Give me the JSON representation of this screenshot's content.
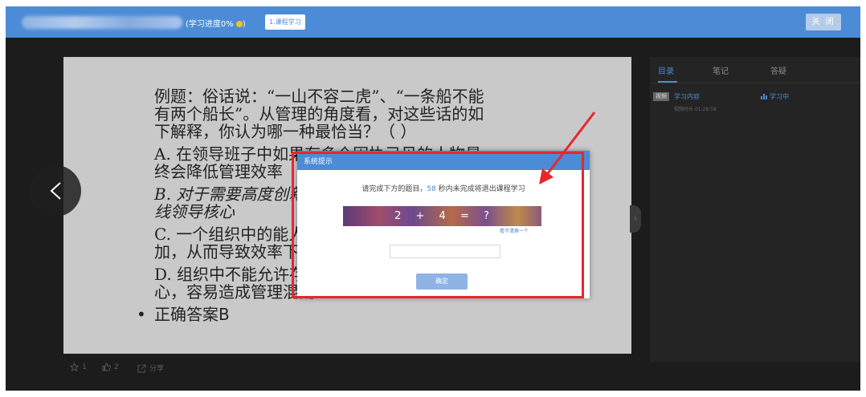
{
  "header": {
    "progress_label": "(学习进度0%",
    "progress_suffix": ")",
    "tag_label": "1.课程学习",
    "close_label": "关 闭",
    "accent_color": "#4c8bd6"
  },
  "slide": {
    "question": "例题：俗话说：“一山不容二虎”、“一条船不能有两个船长”。从管理的角度看，对这些话的如下解释，你认为哪一种最恰当？（    ）",
    "option_a": "A. 在领导班子中如果有多个固执己见的人物最终会降低管理效率",
    "option_b": "B. 对于需要高度创新的任务，必须确立一个直线领导核心",
    "option_c": "C. 一个组织中的能人太多必然会造成内耗增加，从而导致效率下降",
    "option_d": "D. 组织中不能允许存在两个以上的直线领导核心，容易造成管理混乱",
    "answer_bullet": "•",
    "answer": "正确答案B"
  },
  "sidepanel": {
    "tabs": [
      "目录",
      "笔记",
      "答疑"
    ],
    "active_tab": 0,
    "lesson_badge": "视频",
    "lesson_title": "学习内容",
    "lesson_meta": "视频时长 01:28:58",
    "lesson_status": "学习中"
  },
  "bottom_bar": {
    "likes": "1",
    "thumbs": "2",
    "share": "分享"
  },
  "dialog": {
    "title": "系统提示",
    "msg_before": "请完成下方的题目，",
    "seconds": "58",
    "msg_after": " 秒内未完成将退出课程学习",
    "captcha_text": "2 + 4 = ?",
    "refresh_label": "看不清换一个",
    "input_value": "",
    "confirm_label": "确定"
  },
  "annotation": {
    "color": "#e8262e"
  }
}
